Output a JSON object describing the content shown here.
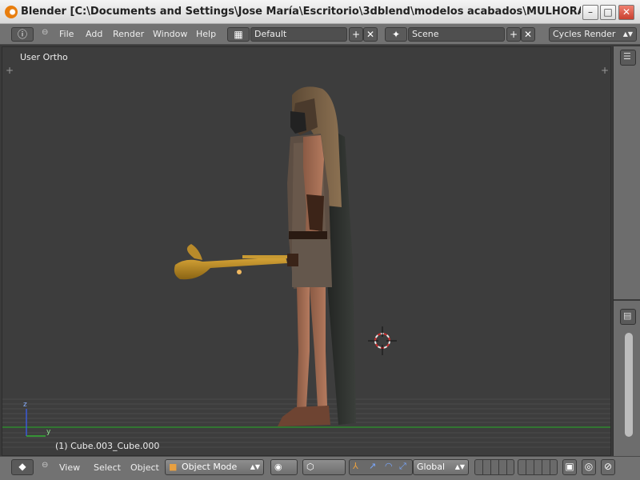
{
  "window": {
    "title": "Blender [C:\\Documents and Settings\\Jose María\\Escritorio\\3dblend\\modelos acabados\\MULHORAND\\FANGS OF ...",
    "minimize": "–",
    "maximize": "□",
    "close": "✕"
  },
  "menu": {
    "items": [
      "File",
      "Add",
      "Render",
      "Window",
      "Help"
    ],
    "layout": "Default",
    "scene": "Scene",
    "render_engine": "Cycles Render"
  },
  "viewport": {
    "label": "User Ortho",
    "object_info": "(1) Cube.003_Cube.000",
    "axis_z": "z",
    "axis_y": "y"
  },
  "bottom": {
    "items": [
      "View",
      "Select",
      "Object"
    ],
    "mode": "Object Mode",
    "orientation": "Global"
  },
  "colors": {
    "accent": "#e87d0d",
    "viewport_bg": "#3d3d3d",
    "header_bg": "#727272"
  }
}
